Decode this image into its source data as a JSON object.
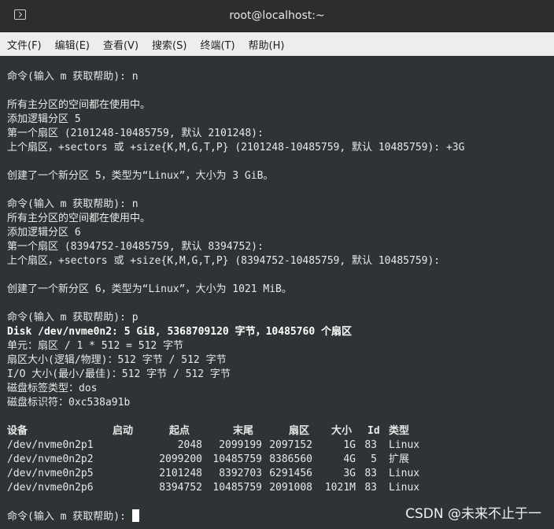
{
  "window": {
    "title": "root@localhost:~"
  },
  "menu": [
    "文件(F)",
    "编辑(E)",
    "查看(V)",
    "搜索(S)",
    "终端(T)",
    "帮助(H)"
  ],
  "terminal": {
    "lines": [
      "命令(输入 m 获取帮助): n",
      "",
      "所有主分区的空间都在使用中。",
      "添加逻辑分区 5",
      "第一个扇区 (2101248-10485759, 默认 2101248):",
      "上个扇区，+sectors 或 +size{K,M,G,T,P} (2101248-10485759, 默认 10485759): +3G",
      "",
      "创建了一个新分区 5，类型为“Linux”，大小为 3 GiB。",
      "",
      "命令(输入 m 获取帮助): n",
      "所有主分区的空间都在使用中。",
      "添加逻辑分区 6",
      "第一个扇区 (8394752-10485759, 默认 8394752):",
      "上个扇区，+sectors 或 +size{K,M,G,T,P} (8394752-10485759, 默认 10485759):",
      "",
      "创建了一个新分区 6，类型为“Linux”，大小为 1021 MiB。",
      "",
      "命令(输入 m 获取帮助): p",
      "Disk /dev/nvme0n2: 5 GiB, 5368709120 字节，10485760 个扇区",
      "单元：扇区 / 1 * 512 = 512 字节",
      "扇区大小(逻辑/物理)：512 字节 / 512 字节",
      "I/O 大小(最小/最佳)：512 字节 / 512 字节",
      "磁盘标签类型：dos",
      "磁盘标识符：0xc538a91b"
    ],
    "table_header": {
      "device": "设备",
      "start": "启动",
      "begin": "起点",
      "end": "末尾",
      "sectors": "扇区",
      "size": "大小",
      "id": "Id",
      "type": "类型"
    },
    "table_rows": [
      {
        "device": "/dev/nvme0n2p1",
        "start": "",
        "begin": "2048",
        "end": "2099199",
        "sectors": "2097152",
        "size": "1G",
        "id": "83",
        "type": "Linux"
      },
      {
        "device": "/dev/nvme0n2p2",
        "start": "",
        "begin": "2099200",
        "end": "10485759",
        "sectors": "8386560",
        "size": "4G",
        "id": "5",
        "type": "扩展"
      },
      {
        "device": "/dev/nvme0n2p5",
        "start": "",
        "begin": "2101248",
        "end": "8392703",
        "sectors": "6291456",
        "size": "3G",
        "id": "83",
        "type": "Linux"
      },
      {
        "device": "/dev/nvme0n2p6",
        "start": "",
        "begin": "8394752",
        "end": "10485759",
        "sectors": "2091008",
        "size": "1021M",
        "id": "83",
        "type": "Linux"
      }
    ],
    "prompt": "命令(输入 m 获取帮助): "
  },
  "watermark": "CSDN @未来不止于一"
}
